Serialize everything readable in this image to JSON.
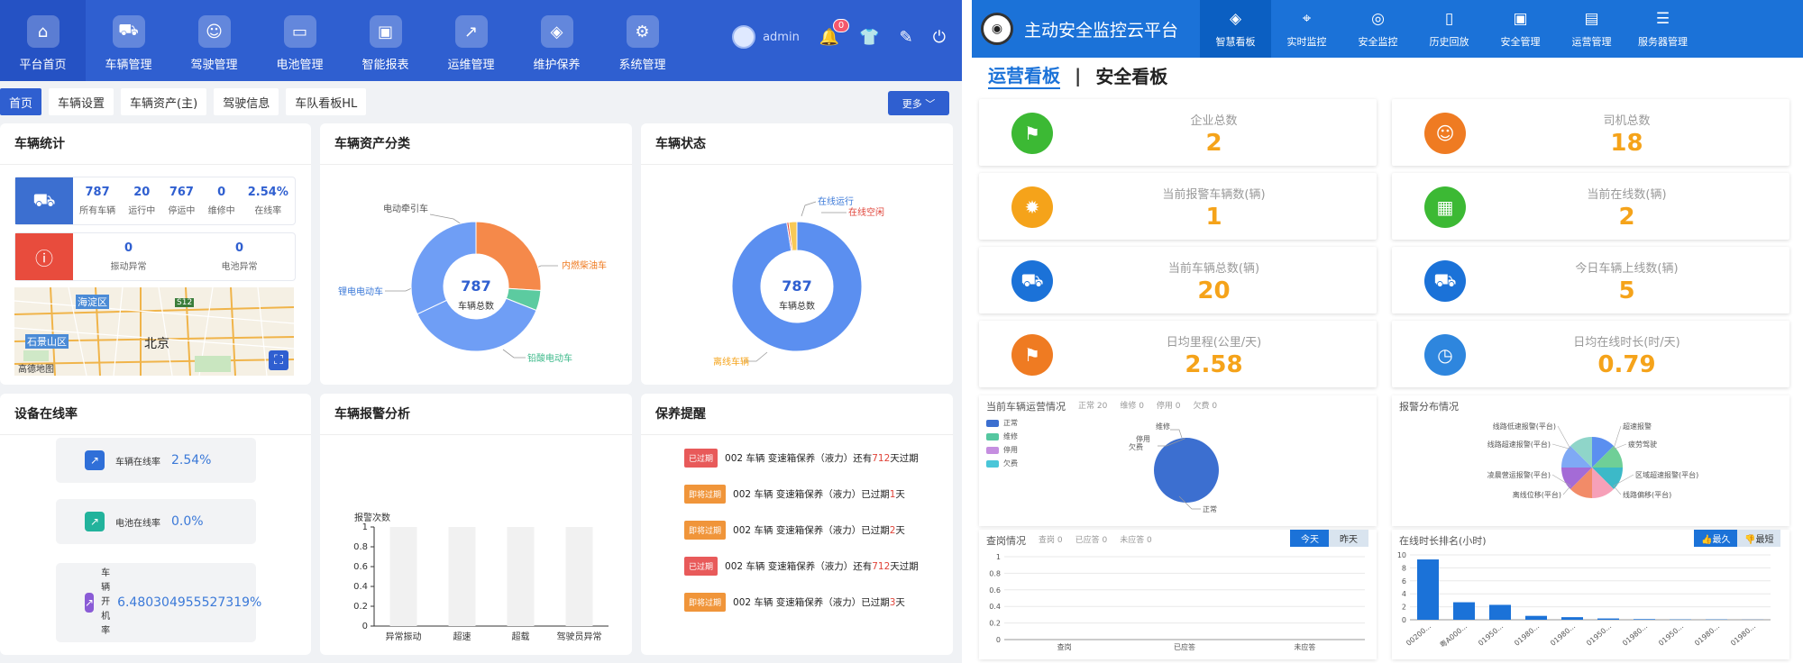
{
  "left": {
    "nav": [
      {
        "label": "平台首页",
        "icon": "home-icon",
        "glyph": "⌂",
        "active": true
      },
      {
        "label": "车辆管理",
        "icon": "car-icon",
        "glyph": "⛟"
      },
      {
        "label": "驾驶管理",
        "icon": "driver-icon",
        "glyph": "☺"
      },
      {
        "label": "电池管理",
        "icon": "battery-icon",
        "glyph": "▭"
      },
      {
        "label": "智能报表",
        "icon": "monitor-icon",
        "glyph": "▣"
      },
      {
        "label": "运维管理",
        "icon": "chart-icon",
        "glyph": "↗"
      },
      {
        "label": "维护保养",
        "icon": "shield-icon",
        "glyph": "◈"
      },
      {
        "label": "系统管理",
        "icon": "gear-icon",
        "glyph": "⚙"
      }
    ],
    "user": "admin",
    "bell_count": "0",
    "tabs": [
      "首页",
      "车辆设置",
      "车辆资产(主)",
      "驾驶信息",
      "车队看板HL"
    ],
    "more_label": "更多 ﹀",
    "vehicle_stats": {
      "title": "车辆统计",
      "row1": [
        {
          "n": "787",
          "l": "所有车辆"
        },
        {
          "n": "20",
          "l": "运行中"
        },
        {
          "n": "767",
          "l": "停运中"
        },
        {
          "n": "0",
          "l": "维修中"
        },
        {
          "n": "2.54%",
          "l": "在线率"
        }
      ],
      "row2": [
        {
          "n": "0",
          "l": "振动异常"
        },
        {
          "n": "0",
          "l": "电池异常"
        }
      ],
      "map_labels": {
        "haidian": "海淀区",
        "shijingshan": "石景山区",
        "beijing": "北京",
        "road": "S12",
        "logo": "高德地图"
      }
    },
    "asset": {
      "title": "车辆资产分类",
      "center_value": "787",
      "center_label": "车辆总数",
      "labels": {
        "a": "电动牵引车",
        "b": "内燃柴油车",
        "c": "锂电电动车",
        "d": "铅酸电动车"
      }
    },
    "status": {
      "title": "车辆状态",
      "center_value": "787",
      "center_label": "车辆总数",
      "labels": {
        "a": "在线运行",
        "b": "在线空闲",
        "c": "离线车辆"
      }
    },
    "device": {
      "title": "设备在线率",
      "items": [
        {
          "label": "车辆在线率",
          "value": "2.54%"
        },
        {
          "label": "电池在线率",
          "value": "0.0%"
        },
        {
          "label": "车辆开机率",
          "value": "6.480304955527319%"
        }
      ]
    },
    "alarm": {
      "title": "车辆报警分析",
      "ylabel": "报警次数",
      "yticks": [
        "1",
        "0.8",
        "0.6",
        "0.4",
        "0.2",
        "0"
      ],
      "categories": [
        "异常振动",
        "超速",
        "超载",
        "驾驶员异常"
      ]
    },
    "maint": {
      "title": "保养提醒",
      "rows": [
        {
          "tag": "已过期",
          "color": "#e85a5a",
          "pre": "002 车辆 变速箱保养（液力）还有",
          "num": "712",
          "post": "天过期"
        },
        {
          "tag": "即将过期",
          "color": "#f0953a",
          "pre": "002 车辆 变速箱保养（液力）已过期",
          "num": "1",
          "post": "天"
        },
        {
          "tag": "即将过期",
          "color": "#f0953a",
          "pre": "002 车辆 变速箱保养（液力）已过期",
          "num": "2",
          "post": "天"
        },
        {
          "tag": "已过期",
          "color": "#e85a5a",
          "pre": "002 车辆 变速箱保养（液力）还有",
          "num": "712",
          "post": "天过期"
        },
        {
          "tag": "即将过期",
          "color": "#f0953a",
          "pre": "002 车辆 变速箱保养（液力）已过期",
          "num": "3",
          "post": "天"
        }
      ]
    }
  },
  "right": {
    "app_title": "主动安全监控云平台",
    "nav": [
      {
        "label": "智慧看板",
        "glyph": "◈",
        "active": true
      },
      {
        "label": "实时监控",
        "glyph": "⌖"
      },
      {
        "label": "安全监控",
        "glyph": "◎"
      },
      {
        "label": "历史回放",
        "glyph": "▯"
      },
      {
        "label": "安全管理",
        "glyph": "▣"
      },
      {
        "label": "运营管理",
        "glyph": "▤"
      },
      {
        "label": "服务器管理",
        "glyph": "☰"
      }
    ],
    "heading1": "运营看板",
    "heading_sep": "|",
    "heading2": "安全看板",
    "kpis": [
      {
        "label": "企业总数",
        "value": "2",
        "color": "#3cb934",
        "glyph": "⚑"
      },
      {
        "label": "司机总数",
        "value": "18",
        "color": "#ef7b22",
        "glyph": "☺"
      },
      {
        "label": "当前报警车辆数(辆)",
        "value": "1",
        "color": "#f5a31a",
        "glyph": "✹"
      },
      {
        "label": "当前在线数(辆)",
        "value": "2",
        "color": "#3cb934",
        "glyph": "▦"
      },
      {
        "label": "当前车辆总数(辆)",
        "value": "20",
        "color": "#1b72d8",
        "glyph": "⛟"
      },
      {
        "label": "今日车辆上线数(辆)",
        "value": "5",
        "color": "#1b72d8",
        "glyph": "⛟"
      },
      {
        "label": "日均里程(公里/天)",
        "value": "2.58",
        "color": "#ef7b22",
        "glyph": "⚑"
      },
      {
        "label": "日均在线时长(时/天)",
        "value": "0.79",
        "color": "#2e86de",
        "glyph": "◷"
      }
    ],
    "ops": {
      "title": "当前车辆运营情况",
      "subs": [
        "正常 20",
        "维修 0",
        "停用 0",
        "欠费 0"
      ],
      "legend": [
        {
          "label": "正常",
          "color": "#3c6fd0"
        },
        {
          "label": "维修",
          "color": "#55c7a0"
        },
        {
          "label": "停用",
          "color": "#c58ee0"
        },
        {
          "label": "欠费",
          "color": "#4ac6d8"
        }
      ],
      "pie_labels": {
        "weixiu": "维修",
        "tingyong": "停用",
        "qianfei": "欠费",
        "zhengchang": "正常"
      }
    },
    "alarm_dist": {
      "title": "报警分布情况",
      "labels": [
        "超速报警",
        "疲劳驾驶",
        "区域超速报警(平台)",
        "线路偏移(平台)",
        "离线位移(平台)",
        "凌晨营运报警(平台)",
        "线路超速报警(平台)",
        "线路低速报警(平台)"
      ]
    },
    "check": {
      "title": "查岗情况",
      "subs": [
        "查岗 0",
        "已应答 0",
        "未应答 0"
      ],
      "btn_today": "今天",
      "btn_yesterday": "昨天",
      "yticks": [
        "1",
        "0.8",
        "0.6",
        "0.4",
        "0.2",
        "0"
      ],
      "categories": [
        "查岗",
        "已应答",
        "未应答"
      ]
    },
    "rank": {
      "title": "在线时长排名(小时)",
      "btn_most": "最久",
      "btn_least": "最短",
      "yticks": [
        "10",
        "8",
        "6",
        "4",
        "2",
        "0"
      ],
      "categories": [
        "00200...",
        "粤A000...",
        "01950...",
        "01980...",
        "01980...",
        "01950...",
        "01980...",
        "01950...",
        "01980...",
        "01980..."
      ]
    }
  },
  "chart_data": [
    {
      "type": "pie",
      "title": "车辆资产分类",
      "categories": [
        "电动牵引车",
        "内燃柴油车",
        "锂电电动车",
        "铅酸电动车"
      ],
      "values": [
        0.32,
        0.26,
        0.37,
        0.05
      ]
    },
    {
      "type": "pie",
      "title": "车辆状态",
      "categories": [
        "在线运行",
        "在线空闲",
        "离线车辆"
      ],
      "values": [
        0.02,
        0.005,
        0.975
      ]
    },
    {
      "type": "bar",
      "title": "车辆报警分析",
      "categories": [
        "异常振动",
        "超速",
        "超载",
        "驾驶员异常"
      ],
      "values": [
        0,
        0,
        0,
        0
      ],
      "ylabel": "报警次数",
      "ylim": [
        0,
        1
      ]
    },
    {
      "type": "pie",
      "title": "当前车辆运营情况",
      "categories": [
        "正常",
        "维修",
        "停用",
        "欠费"
      ],
      "values": [
        20,
        0,
        0,
        0
      ]
    },
    {
      "type": "pie",
      "title": "报警分布情况",
      "categories": [
        "超速报警",
        "疲劳驾驶",
        "区域超速报警(平台)",
        "线路偏移(平台)",
        "离线位移(平台)",
        "凌晨营运报警(平台)",
        "线路超速报警(平台)",
        "线路低速报警(平台)"
      ],
      "values": [
        1,
        1,
        1,
        1,
        1,
        1,
        1,
        1
      ]
    },
    {
      "type": "bar",
      "title": "查岗情况",
      "categories": [
        "查岗",
        "已应答",
        "未应答"
      ],
      "values": [
        0,
        0,
        0
      ],
      "ylim": [
        0,
        1
      ]
    },
    {
      "type": "bar",
      "title": "在线时长排名(小时)",
      "categories": [
        "00200...",
        "粤A000...",
        "01950...",
        "01980...",
        "01980...",
        "01950...",
        "01980...",
        "01950...",
        "01980...",
        "01980..."
      ],
      "values": [
        9.3,
        2.7,
        2.3,
        0.6,
        0.4,
        0.2,
        0.1,
        0.05,
        0.05,
        0.02
      ],
      "ylim": [
        0,
        10
      ]
    }
  ]
}
